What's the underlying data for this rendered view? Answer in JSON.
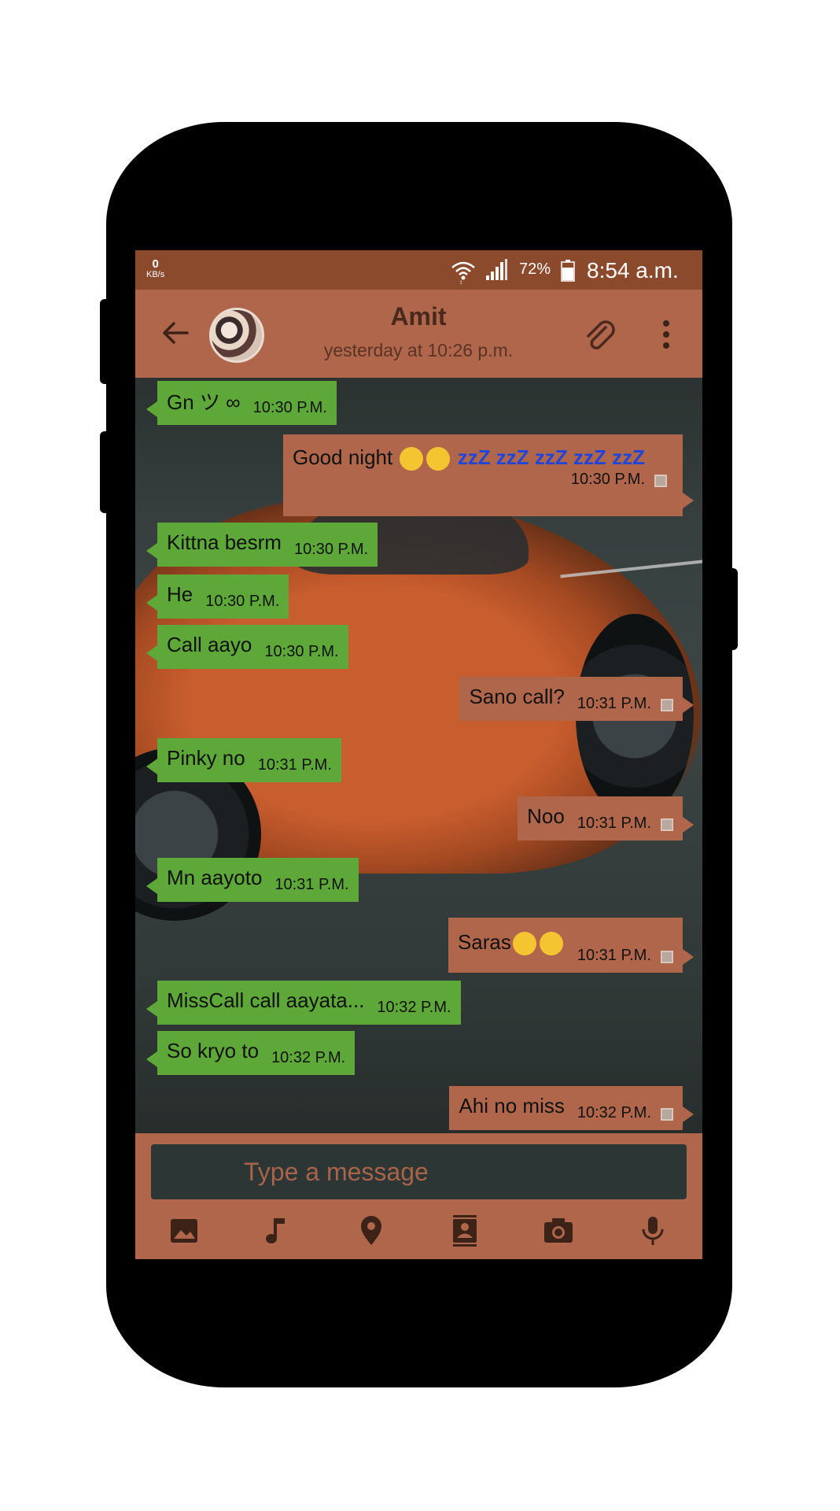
{
  "status_bar": {
    "data_speed_value": "0",
    "data_speed_unit": "KB/s",
    "battery": "72%",
    "time": "8:54 a.m."
  },
  "contact": {
    "name": "Amit",
    "last_seen": "yesterday at 10:26 p.m."
  },
  "messages": [
    {
      "dir": "in",
      "text": "Gn ツ ∞",
      "time": "10:30 P.M."
    },
    {
      "dir": "out",
      "text": "Good night",
      "time": "10:30 P.M."
    },
    {
      "dir": "in",
      "text": "Kittna besrm",
      "time": "10:30 P.M."
    },
    {
      "dir": "in",
      "text": "He",
      "time": "10:30 P.M."
    },
    {
      "dir": "in",
      "text": "Call aayo",
      "time": "10:30 P.M."
    },
    {
      "dir": "out",
      "text": "Sano call?",
      "time": "10:31 P.M."
    },
    {
      "dir": "in",
      "text": "Pinky no",
      "time": "10:31 P.M."
    },
    {
      "dir": "out",
      "text": "Noo",
      "time": "10:31 P.M."
    },
    {
      "dir": "in",
      "text": "Mn aayoto",
      "time": "10:31 P.M."
    },
    {
      "dir": "out",
      "text": "Saras",
      "time": "10:31 P.M."
    },
    {
      "dir": "in",
      "text": "MissCall call aayata...",
      "time": "10:32 P.M."
    },
    {
      "dir": "in",
      "text": "So kryo to",
      "time": "10:32 P.M."
    },
    {
      "dir": "out",
      "text": "Ahi no miss",
      "time": "10:32 P.M."
    }
  ],
  "composer": {
    "placeholder": "Type a message"
  },
  "icons": {
    "back": "arrow-back-icon",
    "attach": "paperclip-icon",
    "menu": "more-vert-icon",
    "attach_row": [
      "image-icon",
      "music-note-icon",
      "location-pin-icon",
      "contact-card-icon",
      "camera-icon",
      "microphone-icon"
    ]
  },
  "colors": {
    "status_bar": "#8b4a2c",
    "app_bar": "#b0664b",
    "incoming_bubble": "#5ea83a",
    "outgoing_bubble": "#b0664b",
    "input_field": "#2c3634"
  }
}
